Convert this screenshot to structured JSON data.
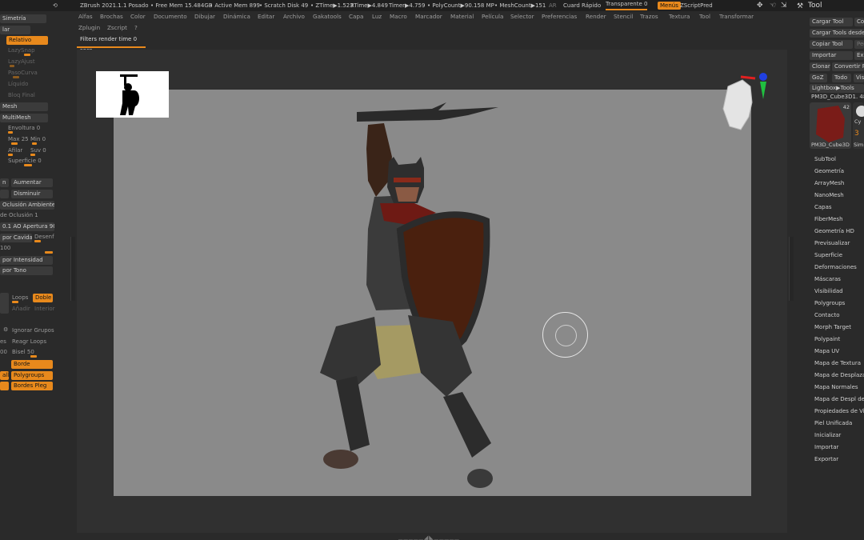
{
  "app": {
    "title": "ZBrush 2021.1.1 Posado",
    "stats": {
      "free_mem": "• Free Mem 15.484GB",
      "active_mem": "• Active Mem 899",
      "scratch": "• Scratch Disk 49",
      "ztime": "• ZTime▶1.523",
      "rtime": "RTime▶4.849",
      "timer": "Timer▶4.759",
      "polycount": "• PolyCount▶90.158 MP",
      "meshcount": "• MeshCount▶151"
    },
    "ar": "AR",
    "quick_save": "Cuard Rápido",
    "transparency": "Transparente 0",
    "menus_label": "Menús",
    "default_script": "ZScriptPred"
  },
  "menu": {
    "row1": [
      "Alfas",
      "Brochas",
      "Color",
      "Documento",
      "Dibujar",
      "Dinámica",
      "Editar",
      "Archivo",
      "Gakatools",
      "Capa",
      "Luz",
      "Macro",
      "Marcador",
      "Material",
      "Película",
      "Selector",
      "Preferencias",
      "Render",
      "Stencil",
      "Trazos",
      "Textura",
      "Tool",
      "Transformar"
    ],
    "row2": [
      "Zplugin",
      "Zscript",
      "?"
    ]
  },
  "document": {
    "tab_label": "Filters render time 0 secs"
  },
  "left_panel": {
    "simetria": "Simetría",
    "lar": "lar",
    "relativo": "Relativo",
    "lazysnap": "LazySnap",
    "lazyajust": "LazyAjust",
    "pasocurva": "PasoCurva",
    "liquido": "Líquido",
    "bloq_final": "Bloq Final",
    "mesh": "Mesh",
    "multimesh": "MultiMesh",
    "envoltura": "Envoltura 0",
    "max": "Max 25",
    "min": "Min 0",
    "afilar": "Afilar",
    "suv": "Suv 0",
    "superficie": "Superficie 0",
    "a_btn": "n",
    "aumentar": "Aumentar",
    "disminuir": "Disminuir",
    "oclusion_amb": "Oclusión Ambiente",
    "oclusion_val": "de Oclusión 1",
    "ao_apertura": "0.1 AO Apertura 90",
    "por_cavidad": "por Cavidad",
    "desenf": "Desenf",
    "val100": "100",
    "por_intensidad": "por Intensidad",
    "por_tono": "por Tono",
    "loops": "Loops",
    "doble": "Doble",
    "anadir": "Añadir",
    "interior": "Interior",
    "ignorar_grupos": "Ignorar Grupos",
    "es": "es",
    "reagr_loops": "Reagr Loops",
    "val00": "00",
    "bisel": "Bisel 50",
    "borde": "Borde",
    "polygroups": "Polygroups",
    "bordes_pleg": "Bordes Pleg",
    "alla": "alla"
  },
  "tool_panel": {
    "title": "Tool",
    "cargar_tool": "Cargar Tool",
    "cargar_tool_2": "Cop",
    "cargar_desde": "Cargar Tools desde",
    "copiar_tool": "Copiar Tool",
    "pegar": "Peg",
    "importar_btn": "Importar",
    "exp": "Exp",
    "clonar": "Clonar",
    "convertir": "Convertir P",
    "goz": "GoZ",
    "todo": "Todo",
    "vis": "Vis",
    "lightbox_tools": "Lightbox▶Tools",
    "pm3d_label": "PM3D_Cube3D1. 48",
    "thumb_label": "PM3D_Cube3D",
    "thumb_num": "42",
    "cyl": "Cy",
    "sim": "Sim",
    "sections": [
      "SubTool",
      "Geometría",
      "ArrayMesh",
      "NanoMesh",
      "Capas",
      "FiberMesh",
      "Geometría HD",
      "Previsualizar",
      "Superficie",
      "Deformaciones",
      "Máscaras",
      "Visibilidad",
      "Polygroups",
      "Contacto",
      "Morph Target",
      "Polypaint",
      "Mapa UV",
      "Mapa de Textura",
      "Mapa de Desplazam",
      "Mapa Normales",
      "Mapa de Despl de V",
      "Propiedades de Vis",
      "Piel Unificada",
      "Inicializar",
      "Importar",
      "Exportar"
    ]
  },
  "icons": {
    "move": "arrows-icon",
    "tool": "hammer-icon"
  },
  "colors": {
    "accent": "#e8891c",
    "canvas": "#8a8a8a",
    "background": "#2a2a2a"
  }
}
